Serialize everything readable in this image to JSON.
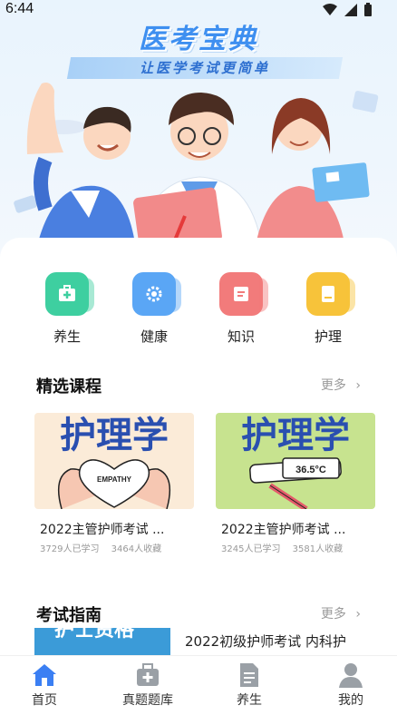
{
  "status_bar": {
    "time": "6:44"
  },
  "hero": {
    "title": "医考宝典",
    "subtitle": "让医学考试更简单"
  },
  "categories": [
    {
      "label": "养生",
      "icon": "medical-kit-icon",
      "color": "#3ecfa0"
    },
    {
      "label": "健康",
      "icon": "health-gear-icon",
      "color": "#5aa6f5"
    },
    {
      "label": "知识",
      "icon": "knowledge-card-icon",
      "color": "#f27b7b"
    },
    {
      "label": "护理",
      "icon": "nursing-book-icon",
      "color": "#f7c33a"
    }
  ],
  "featured": {
    "title": "精选课程",
    "more": "更多",
    "courses": [
      {
        "thumb_text": "护理学",
        "thumb_caption": "EMPATHY",
        "name": "2022主管护师考试 ...",
        "learners": "3729人已学习",
        "favorites": "3464人收藏"
      },
      {
        "thumb_text": "护理学",
        "thumb_caption": "36.5°C",
        "name": "2022主管护师考试 ...",
        "learners": "3245人已学习",
        "favorites": "3581人收藏"
      }
    ]
  },
  "guide": {
    "title": "考试指南",
    "more": "更多",
    "items": [
      {
        "thumb_text": "护士资格",
        "text": "2022初级护师考试 内科护"
      }
    ]
  },
  "nav": [
    {
      "label": "首页",
      "icon": "home-icon",
      "active": true
    },
    {
      "label": "真题题库",
      "icon": "medical-bag-icon",
      "active": false
    },
    {
      "label": "养生",
      "icon": "document-icon",
      "active": false
    },
    {
      "label": "我的",
      "icon": "profile-icon",
      "active": false
    }
  ],
  "colors": {
    "accent": "#3b7ff3",
    "nav_inactive": "#9aa0a6",
    "title_blue": "#3e8ff0"
  }
}
